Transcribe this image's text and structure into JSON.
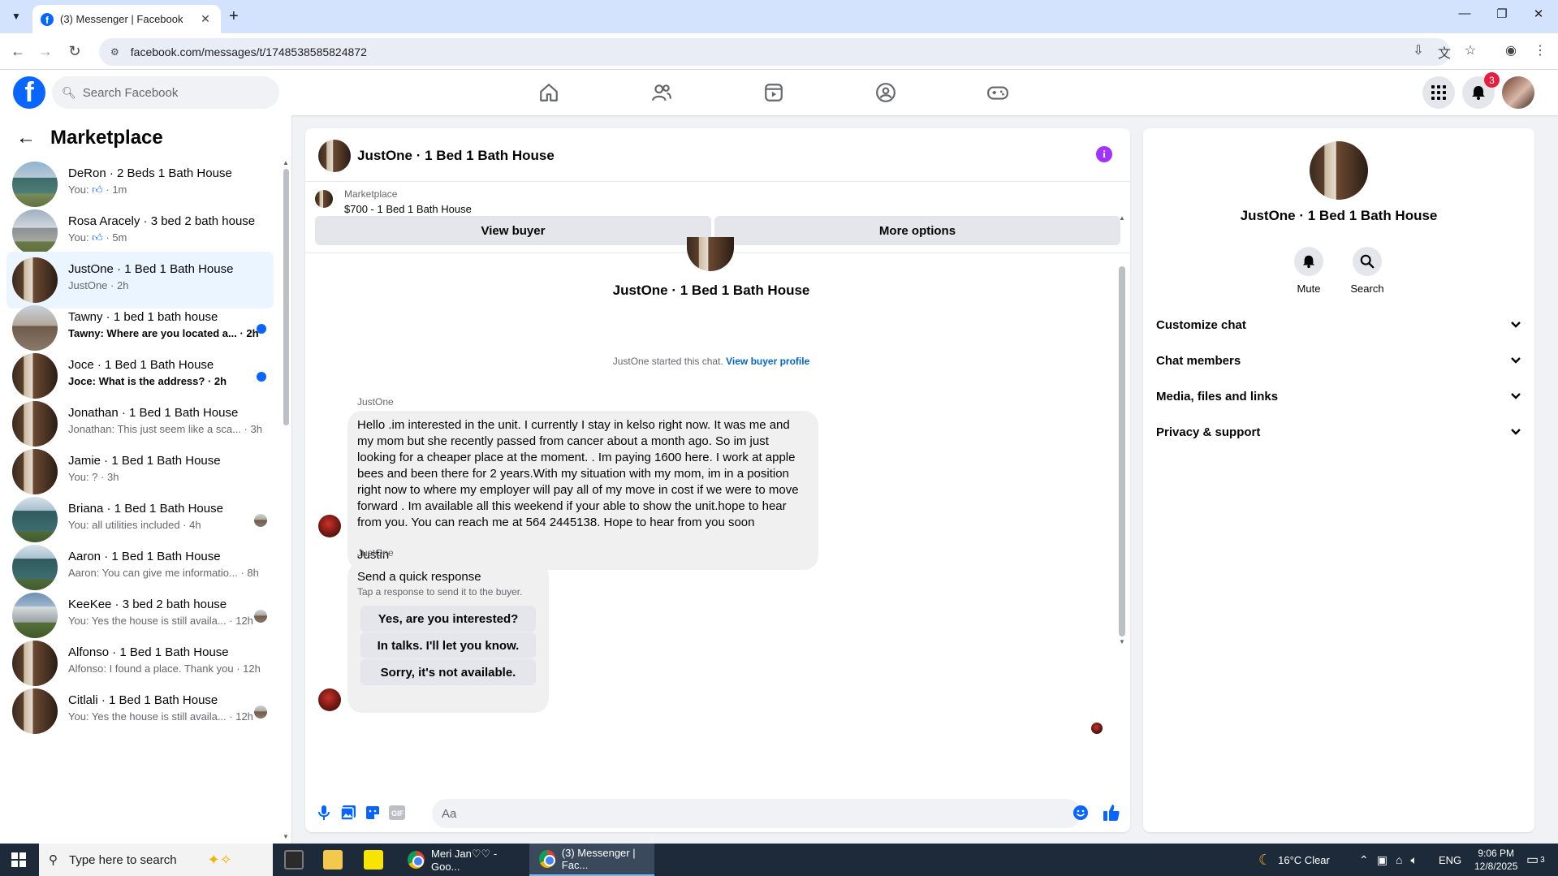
{
  "browser": {
    "tab_title": "(3) Messenger | Facebook",
    "url": "facebook.com/messages/t/1748538585824872"
  },
  "fb_header": {
    "search_placeholder": "Search Facebook",
    "notification_count": "3"
  },
  "left_panel": {
    "title": "Marketplace",
    "conversations": [
      {
        "title": "DeRon · 2 Beds 1 Bath House",
        "preview": "You: ",
        "time": "1m",
        "thumb": "house",
        "unread": false,
        "indicator": "none",
        "liked": true
      },
      {
        "title": "Rosa Aracely · 3 bed 2 bath house",
        "preview": "You: ",
        "time": "5m",
        "thumb": "gray",
        "unread": false,
        "indicator": "none",
        "liked": true
      },
      {
        "title": "JustOne · 1 Bed 1 Bath House",
        "preview": "JustOne",
        "time": "2h",
        "thumb": "door",
        "unread": false,
        "indicator": "none",
        "active": true
      },
      {
        "title": "Tawny · 1 bed 1 bath house",
        "preview": "Tawny: Where are you located a...",
        "time": "2h",
        "thumb": "street",
        "unread": true,
        "indicator": "dot"
      },
      {
        "title": "Joce · 1 Bed 1 Bath House",
        "preview": "Joce: What is the address?",
        "time": "2h",
        "thumb": "door",
        "unread": true,
        "indicator": "dot"
      },
      {
        "title": "Jonathan · 1 Bed 1 Bath House",
        "preview": "Jonathan: This just seem like a sca...",
        "time": "3h",
        "thumb": "door",
        "unread": false,
        "indicator": "none"
      },
      {
        "title": "Jamie · 1 Bed 1 Bath House",
        "preview": "You: ?",
        "time": "3h",
        "thumb": "door",
        "unread": false,
        "indicator": "none"
      },
      {
        "title": "Briana · 1 Bed 1 Bath House",
        "preview": "You: all utilities included",
        "time": "4h",
        "thumb": "teal",
        "unread": false,
        "indicator": "avatar"
      },
      {
        "title": "Aaron · 1 Bed 1 Bath House",
        "preview": "Aaron: You can give me informatio...",
        "time": "8h",
        "thumb": "teal",
        "unread": false,
        "indicator": "none"
      },
      {
        "title": "KeeKee · 3 bed 2 bath house",
        "preview": "You: Yes the house is still availa...",
        "time": "12h",
        "thumb": "trees",
        "unread": false,
        "indicator": "avatar"
      },
      {
        "title": "Alfonso · 1 Bed 1 Bath House",
        "preview": "Alfonso: I found a place. Thank you",
        "time": "12h",
        "thumb": "door",
        "unread": false,
        "indicator": "none"
      },
      {
        "title": "Citlali · 1 Bed 1 Bath House",
        "preview": "You: Yes the house is still availa...",
        "time": "12h",
        "thumb": "door",
        "unread": false,
        "indicator": "avatar"
      }
    ]
  },
  "chat": {
    "title": "JustOne · 1 Bed 1 Bath House",
    "marketplace_label": "Marketplace",
    "listing": "$700 - 1 Bed 1 Bath House",
    "view_buyer": "View buyer",
    "more_options": "More options",
    "intro_title": "JustOne · 1 Bed 1 Bath House",
    "started_text": "JustOne started this chat.",
    "started_link": "View buyer profile",
    "sender_name": "JustOne",
    "message_text": "Hello .im interested in the unit. I currently I stay in kelso right now. It was me and my mom but she recently passed from cancer about a month ago. So im just looking for a cheaper place at the moment. . Im paying 1600 here. I work at apple bees and been there for 2 years.With my situation with my mom, im in a position right now to where my employer will pay all of my move in cost if we were to move forward . Im available all this weekend if your able to show the unit.hope to hear from you. You can reach me at 564 2445138.  Hope to hear from you soon",
    "message_signature": "Justin",
    "quick_sender": "JustOne",
    "quick_title": "Send a quick response",
    "quick_subtitle": "Tap a response to send it to the buyer.",
    "quick_options": [
      "Yes, are you interested?",
      "In talks. I'll let you know.",
      "Sorry, it's not available."
    ],
    "composer_placeholder": "Aa"
  },
  "right_panel": {
    "name": "JustOne · 1 Bed 1 Bath House",
    "mute_label": "Mute",
    "search_label": "Search",
    "sections": [
      "Customize chat",
      "Chat members",
      "Media, files and links",
      "Privacy & support"
    ]
  },
  "taskbar": {
    "search_placeholder": "Type here to search",
    "app1_label": "Meri Jan♡♡ - Goo...",
    "app2_label": "(3) Messenger | Fac...",
    "weather": "16°C  Clear",
    "lang": "ENG",
    "time": "9:06 PM",
    "date": "12/8/2025",
    "notif_count": "3"
  },
  "colors": {
    "fb_blue": "#0866ff",
    "active_row": "#ebf5ff",
    "info_purple": "#a033ff",
    "badge_red": "#e41e3f"
  }
}
